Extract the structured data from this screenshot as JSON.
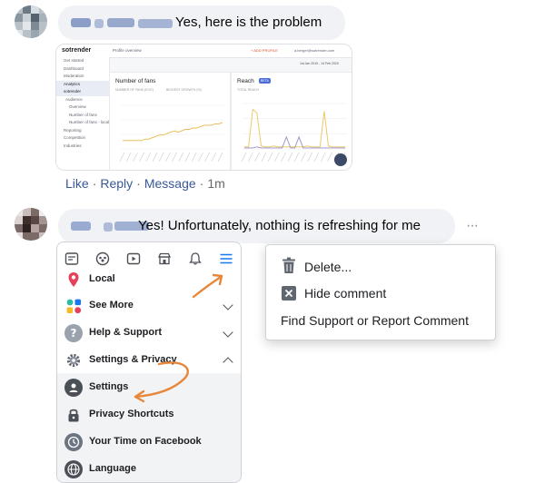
{
  "comment1": {
    "text": "Yes, here is the problem"
  },
  "actions": {
    "like": "Like",
    "reply": "Reply",
    "message": "Message",
    "time": "1m"
  },
  "shot": {
    "brand": "sotrender",
    "page": "Profile overview",
    "add_profile": "+ ADD PROFILE",
    "account": "a.berger@sotrender.com",
    "date_range": "1st Jan 2019 - 14 Feb 2020",
    "sidebar": [
      "Get started",
      "Dashboard",
      "Moderation",
      "Analytics",
      "sotrender",
      "Audience",
      "Overview",
      "Number of fans",
      "Number of fans - local",
      "Reporting",
      "Competition",
      "Industries"
    ],
    "fans_title": "Number of fans",
    "fans_sub": "NUMBER OF FANS (EXIT)",
    "fans_sub2": "BIGGEST GROWTH (%)",
    "reach_title": "Reach",
    "reach_badge": "BETA",
    "reach_sub": "TOTAL REACH",
    "colors": {
      "accent": "#e0492a",
      "fans_line": "#e8b84a",
      "reach_a": "#e8c55a",
      "reach_b": "#9b8cc8",
      "badge": "#4a6cd4"
    },
    "fans_series": [
      6,
      6,
      6,
      6,
      6,
      6,
      7,
      7,
      8,
      9,
      10,
      10,
      11,
      12,
      13,
      12,
      13,
      14,
      14,
      15,
      15,
      16,
      17,
      17,
      17,
      18,
      18,
      19
    ],
    "reach_series_a": [
      2,
      2,
      40,
      36,
      3,
      2,
      2,
      3,
      2,
      2,
      2,
      2,
      2,
      2,
      2,
      3,
      2,
      2,
      2,
      38,
      3,
      2,
      2,
      2,
      2
    ],
    "reach_series_b": [
      1,
      1,
      1,
      2,
      1,
      1,
      1,
      1,
      1,
      1,
      12,
      1,
      1,
      12,
      1,
      1,
      1,
      1,
      1,
      1,
      1,
      1,
      1,
      1,
      1
    ]
  },
  "comment2": {
    "text": "Yes! Unfortunately, nothing is refreshing for me"
  },
  "more_label": "···",
  "menu": {
    "items": [
      {
        "label": "Local",
        "icon": "location-pin-icon"
      },
      {
        "label": "See More",
        "icon": "apps-grid-icon"
      },
      {
        "label": "Help & Support",
        "icon": "question-icon"
      },
      {
        "label": "Settings & Privacy",
        "icon": "gear-icon"
      },
      {
        "label": "Settings",
        "icon": "user-circle-icon"
      },
      {
        "label": "Privacy Shortcuts",
        "icon": "lock-icon"
      },
      {
        "label": "Your Time on Facebook",
        "icon": "clock-icon"
      },
      {
        "label": "Language",
        "icon": "globe-icon"
      }
    ]
  },
  "context_menu": {
    "delete": "Delete...",
    "hide": "Hide comment",
    "report": "Find Support or Report Comment"
  }
}
